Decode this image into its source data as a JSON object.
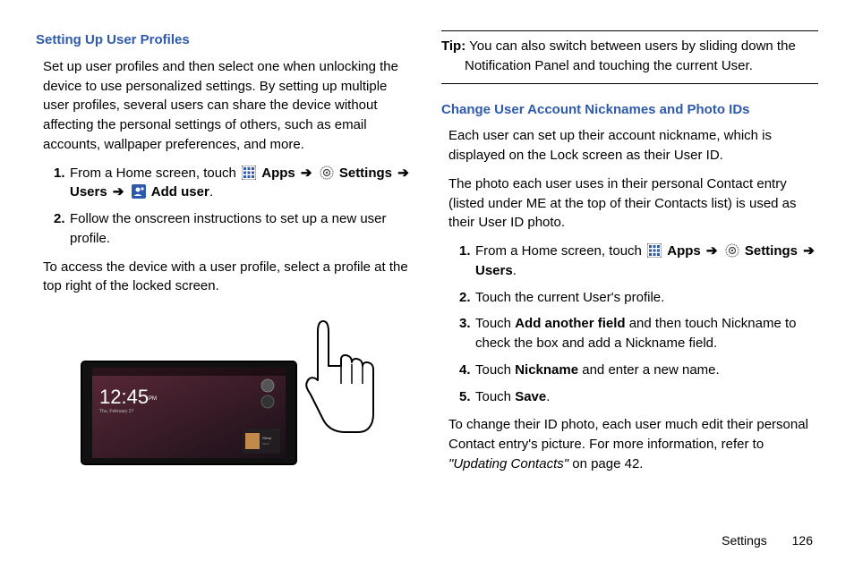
{
  "left": {
    "heading": "Setting Up User Profiles",
    "intro": "Set up user profiles and then select one when unlocking the device to use personalized settings. By setting up multiple user profiles, several users can share the device without affecting the personal settings of others, such as email accounts, wallpaper preferences, and more.",
    "steps": [
      {
        "num": "1.",
        "pre": "From a Home screen, touch ",
        "apps": "Apps",
        "arrow1": "➔",
        "settings": "Settings",
        "arrow2": "➔",
        "users": "Users",
        "arrow3": "➔",
        "adduser": "Add user",
        "post": "."
      },
      {
        "num": "2.",
        "text": "Follow the onscreen instructions to set up a new user profile."
      }
    ],
    "access": "To access the device with a user profile, select a profile at the top right of the locked screen.",
    "clock": "12:45"
  },
  "right": {
    "tip_label": "Tip:",
    "tip_text": " You can also switch between users by sliding down the Notification Panel and touching the current User.",
    "heading": "Change User Account Nicknames and Photo IDs",
    "p1": "Each user can set up their account nickname, which is displayed on the Lock screen as their User ID.",
    "p2": "The photo each user uses in their personal Contact entry (listed under ME at the top of their Contacts list) is used as their User ID photo.",
    "steps": [
      {
        "num": "1.",
        "pre": "From a Home screen, touch ",
        "apps": "Apps",
        "arrow1": "➔",
        "settings": "Settings",
        "arrow2": "➔",
        "users": "Users",
        "post": "."
      },
      {
        "num": "2.",
        "text": "Touch the current User's profile."
      },
      {
        "num": "3.",
        "pre": "Touch ",
        "b": "Add another field",
        "post": " and then touch Nickname to check the box and add a Nickname field."
      },
      {
        "num": "4.",
        "pre": "Touch ",
        "b": "Nickname",
        "post": " and enter a new name."
      },
      {
        "num": "5.",
        "pre": "Touch ",
        "b": "Save",
        "post": "."
      }
    ],
    "outro_pre": "To change their ID photo, each user much edit their personal Contact entry's picture. For more information, refer to ",
    "outro_ref": "\"Updating Contacts\"",
    "outro_post": " on page 42."
  },
  "footer": {
    "section": "Settings",
    "page": "126"
  },
  "icons": {
    "apps": "apps-grid-icon",
    "settings": "settings-gear-icon",
    "adduser": "add-user-icon"
  }
}
